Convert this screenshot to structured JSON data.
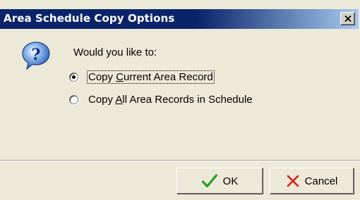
{
  "window": {
    "title": "Area Schedule Copy Options",
    "close_glyph": "✕"
  },
  "dialog": {
    "icon": "question-icon",
    "prompt": "Would you like to:",
    "options": [
      {
        "label_prefix": "Copy ",
        "mnemonic": "C",
        "label_suffix": "urrent Area Record",
        "selected": true
      },
      {
        "label_prefix": "Copy ",
        "mnemonic": "A",
        "label_suffix": "ll Area Records in Schedule",
        "selected": false
      }
    ]
  },
  "buttons": {
    "ok_label": "OK",
    "cancel_label": "Cancel",
    "ok_icon": "checkmark-icon",
    "cancel_icon": "x-icon"
  },
  "colors": {
    "titlebar": "#0a246a",
    "face": "#ece9d8",
    "ok_check": "#2a9d2a",
    "cancel_x": "#d81e1e",
    "question_icon": "#2060c8"
  }
}
